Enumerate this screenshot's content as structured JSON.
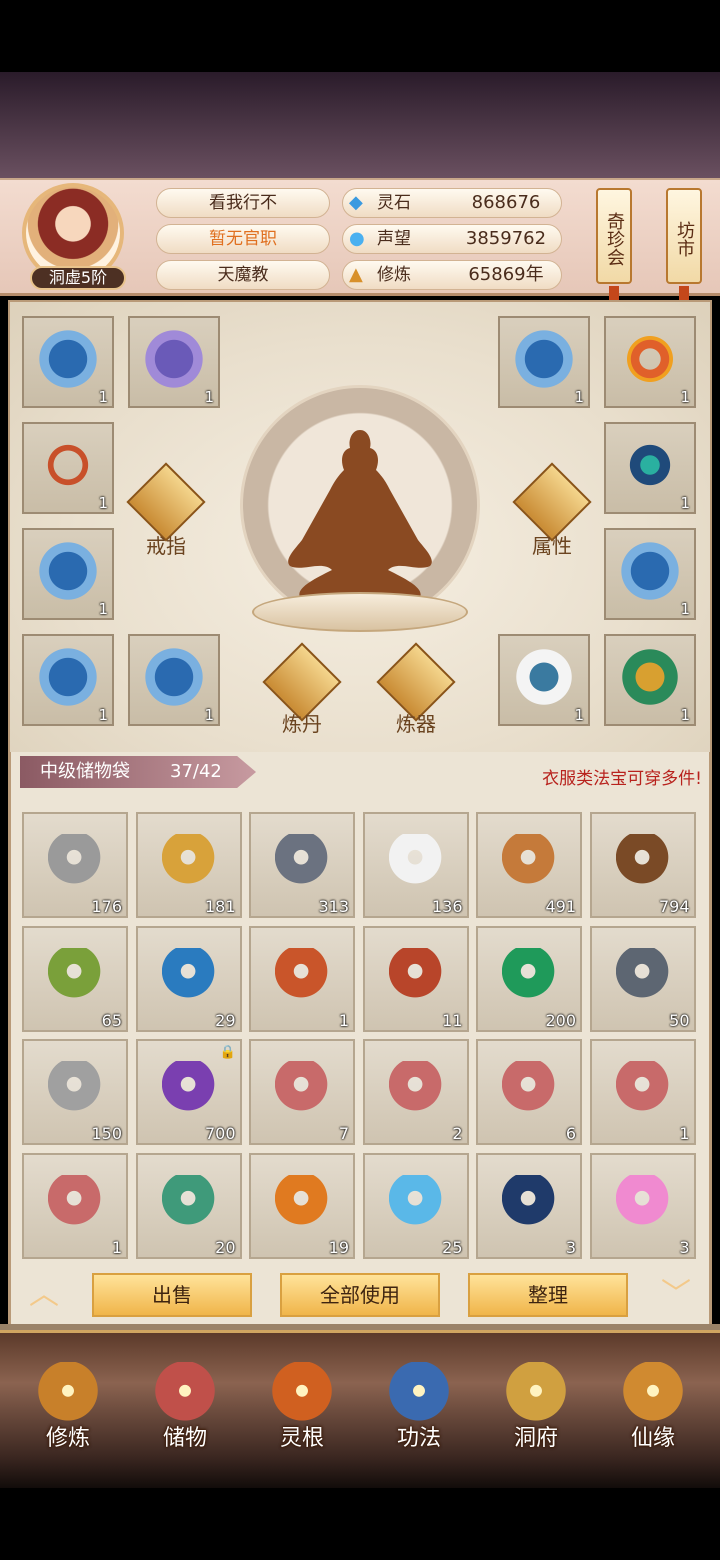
{
  "header": {
    "rank": "洞虚5阶",
    "name": "看我行不",
    "title": "暂无官职",
    "sect": "天魔教",
    "resources": [
      {
        "icon": "spirit-stone-icon",
        "label": "灵石",
        "value": "868676"
      },
      {
        "icon": "prestige-icon",
        "label": "声望",
        "value": "3859762"
      },
      {
        "icon": "cultivation-icon",
        "label": "修炼",
        "value": "65869年"
      }
    ],
    "side_buttons": [
      "奇珍会",
      "坊市"
    ]
  },
  "equipment": {
    "left_slots": [
      {
        "icon": "armor-icon",
        "count": "1"
      },
      {
        "icon": "boots-icon",
        "count": "1"
      },
      {
        "icon": "bow-icon",
        "count": "1"
      },
      {
        "icon": "armor-icon",
        "count": "1"
      },
      {
        "icon": "armor-icon",
        "count": "1"
      },
      {
        "icon": "armor-icon",
        "count": "1"
      }
    ],
    "right_slots": [
      {
        "icon": "armor-icon",
        "count": "1"
      },
      {
        "icon": "ring-icon",
        "count": "1"
      },
      {
        "icon": "ring-icon",
        "count": "1"
      },
      {
        "icon": "armor-icon",
        "count": "1"
      },
      {
        "icon": "white-armor-icon",
        "count": "1"
      },
      {
        "icon": "green-armor-icon",
        "count": "1"
      }
    ],
    "actions": [
      "戒指",
      "属性",
      "炼丹",
      "炼器"
    ]
  },
  "bag": {
    "title": "中级储物袋",
    "capacity": "37/42",
    "note": "衣服类法宝可穿多件!",
    "items": [
      {
        "icon": "silver-ore-icon",
        "count": "176",
        "color": "#9a9a9a"
      },
      {
        "icon": "gold-ore-icon",
        "count": "181",
        "color": "#d8a23a"
      },
      {
        "icon": "dark-ore-icon",
        "count": "313",
        "color": "#6b7280"
      },
      {
        "icon": "white-flower-icon",
        "count": "136",
        "color": "#f2f2f2"
      },
      {
        "icon": "ginseng-icon",
        "count": "491",
        "color": "#c57a3a"
      },
      {
        "icon": "root-herb-icon",
        "count": "794",
        "color": "#7a4a26"
      },
      {
        "icon": "herb-plant-icon",
        "count": "65",
        "color": "#7aa03a"
      },
      {
        "icon": "berry-branch-icon",
        "count": "29",
        "color": "#2a7bbf"
      },
      {
        "icon": "cordyceps-icon",
        "count": "1",
        "color": "#c9552a"
      },
      {
        "icon": "red-crystal-icon",
        "count": "11",
        "color": "#b8452a"
      },
      {
        "icon": "green-crystal-icon",
        "count": "200",
        "color": "#1f9a5a"
      },
      {
        "icon": "iron-ore-icon",
        "count": "50",
        "color": "#5d6672"
      },
      {
        "icon": "silver-ore-icon",
        "count": "150",
        "color": "#a0a0a0"
      },
      {
        "icon": "purple-berry-icon",
        "count": "700",
        "color": "#7a3fb0",
        "locked": true
      },
      {
        "icon": "scroll-bundle-icon",
        "count": "7",
        "color": "#c86a6a"
      },
      {
        "icon": "scroll-bundle-icon",
        "count": "2",
        "color": "#c86a6a"
      },
      {
        "icon": "scroll-bundle-icon",
        "count": "6",
        "color": "#c86a6a"
      },
      {
        "icon": "scroll-bundle-icon",
        "count": "1",
        "color": "#c86a6a"
      },
      {
        "icon": "scroll-bundle-icon",
        "count": "1",
        "color": "#c86a6a"
      },
      {
        "icon": "green-gourd-icon",
        "count": "20",
        "color": "#3f9a7a"
      },
      {
        "icon": "orange-gourd-icon",
        "count": "19",
        "color": "#e07a20"
      },
      {
        "icon": "tea-bowl-icon",
        "count": "25",
        "color": "#5ab8e8"
      },
      {
        "icon": "star-disc-icon",
        "count": "3",
        "color": "#1f3a6a"
      },
      {
        "icon": "lotus-icon",
        "count": "3",
        "color": "#f08ad0"
      }
    ]
  },
  "buttons": {
    "sell": "出售",
    "use_all": "全部使用",
    "sort": "整理"
  },
  "nav": [
    {
      "icon": "cultivate-icon",
      "label": "修炼",
      "color": "#c8802a"
    },
    {
      "icon": "storage-icon",
      "label": "储物",
      "color": "#c0504a"
    },
    {
      "icon": "spirit-root-icon",
      "label": "灵根",
      "color": "#d06020"
    },
    {
      "icon": "technique-icon",
      "label": "功法",
      "color": "#3a6ab0"
    },
    {
      "icon": "cave-icon",
      "label": "洞府",
      "color": "#d0a040"
    },
    {
      "icon": "fate-icon",
      "label": "仙缘",
      "color": "#d08a30"
    }
  ]
}
